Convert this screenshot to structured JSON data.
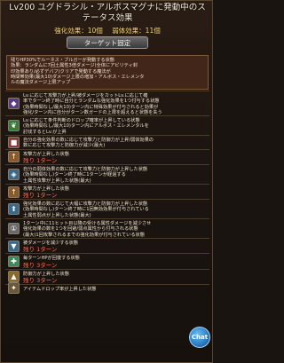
{
  "header": {
    "title": "Lv200 ユグドラシル・アルボスマグナに発動中のステータス効果",
    "enhance_label": "強化効果：10個",
    "debuff_label": "弱体効果：11個",
    "target_button": "ターゲット固定"
  },
  "top_box": {
    "lines": [
      "残りHP30%でルーネス・ブルガーが発動する状態",
      "効果：ランダムに7回土属性3倍ダメージ(全体にアビリティ封",
      "印効果あり/必ずデバフ)クリアで発動する魔法が",
      "時間帯効果(最大10)ダメージ上限の増加・アルボス・エレメンタ",
      "ルの魔法ダメージ上限アップ"
    ]
  },
  "rows": [
    {
      "icon": "crystal-icon",
      "color": "#5a3a8a",
      "lines": [
        "Lv.に応じて攻撃力が上昇/被ダメージをカットLv.に応じて確",
        "率でターン終了時に自分とランダムな強化効果を1つ付与する状態",
        "(効果時間なし/最大10)ターン内に特殊効果が付与されると効果が",
        "強化/ターン内に自分がターン数ガードの上限を超えると状態を失う"
      ],
      "remain": ""
    },
    {
      "icon": "leaf-icon",
      "color": "#3a7a3a",
      "lines": [
        "Lv.に応じて条件判断のドロップ確率が上昇している状態",
        "(効果時間なし/最大10)ターン内にアルボス・エレメンタルを",
        "討伐するとLv.が上昇"
      ],
      "remain": ""
    },
    {
      "icon": "lock-icon",
      "color": "#8a3a3a",
      "lines": [
        "自分の強化効果の数に応じて攻撃力と防御力が上昇/弱体効果の",
        "数に応じて攻撃力と防御力が減少(最大)"
      ],
      "remain": ""
    },
    {
      "icon": "sword-up-icon",
      "color": "#8a5a2a",
      "lines": [
        "攻撃力が上昇した状態"
      ],
      "remain": "残り 1ターン"
    },
    {
      "icon": "shield-icon",
      "color": "#3a6a8a",
      "lines": [
        "自分の弱体効果の数に応じて攻撃力と防御力が上昇した状態",
        "(効果時間なし)ターン終了時に1ターンが経過する",
        "土属性攻撃が上昇した状態(最大)"
      ],
      "remain": ""
    },
    {
      "icon": "sword-up-icon",
      "color": "#8a5a2a",
      "lines": [
        "攻撃力が上昇した状態"
      ],
      "remain": "残り 1ターン"
    },
    {
      "icon": "shield-up-icon",
      "color": "#3a6a8a",
      "lines": [
        "強化効果の数に応じて大幅に攻撃力と防御力が上昇した状態",
        "(効果時間なし)ターン終了時に1回無効効果が付与されている",
        "土属性弱点が上昇した状態(最大)"
      ],
      "remain": ""
    },
    {
      "icon": "turn-icon",
      "color": "#6a6a6a",
      "lines": [
        "1ターン中に11ヒット目以降の受ける属性ダメージを減少させ",
        "強化効果の数を1つを回避/弱点属性から付与される状態",
        "(最大)1回攻撃されるまでの強化効果が付与されている状態"
      ],
      "remain": ""
    },
    {
      "icon": "shield-cut-icon",
      "color": "#3a6a8a",
      "lines": [
        "被ダメージを減少する状態"
      ],
      "remain": "残り 1ターン"
    },
    {
      "icon": "heal-icon",
      "color": "#3a8a5a",
      "lines": [
        "毎ターンHPが回復する状態"
      ],
      "remain": "残り 3ターン"
    },
    {
      "icon": "defense-up-icon",
      "color": "#8a6a2a",
      "lines": [
        "防御力が上昇した状態"
      ],
      "remain": "残り 3ターン"
    },
    {
      "icon": "item-icon",
      "color": "#6a5a3a",
      "lines": [
        "アイテムドロップ率が上昇した状態"
      ],
      "remain": ""
    }
  ],
  "chat": {
    "label": "Chat"
  }
}
